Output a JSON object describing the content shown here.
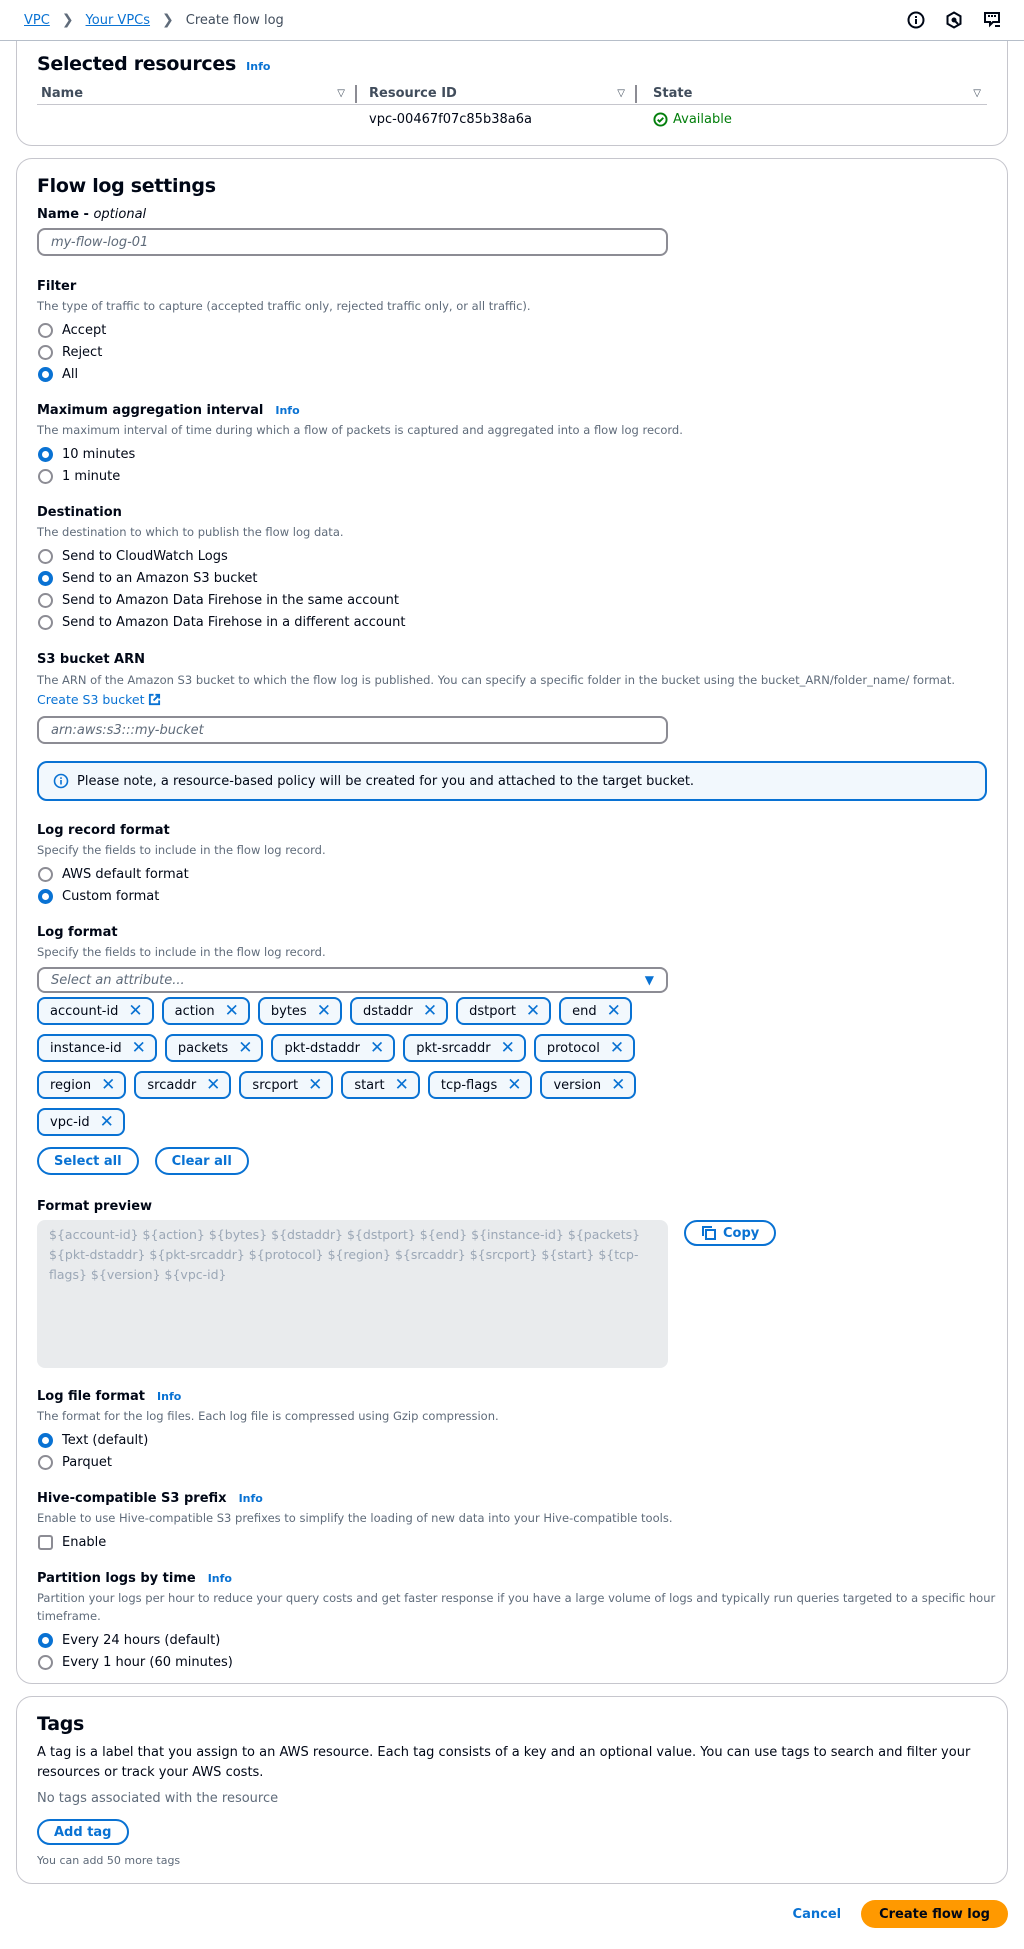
{
  "breadcrumbs": [
    {
      "label": "VPC",
      "link": true
    },
    {
      "label": "Your VPCs",
      "link": true
    },
    {
      "label": "Create flow log",
      "link": false
    }
  ],
  "top_icons": [
    "info-icon",
    "cloudshell-hex-icon",
    "feedback-icon"
  ],
  "selected_resources": {
    "title": "Selected resources",
    "info": "Info",
    "columns": [
      "Name",
      "Resource ID",
      "State"
    ],
    "rows": [
      {
        "name": "",
        "resource_id": "vpc-00467f07c85b38a6a",
        "state": "Available"
      }
    ]
  },
  "flow_log_settings": {
    "title": "Flow log settings",
    "name_label": "Name - ",
    "name_optional": "optional",
    "name_placeholder": "my-flow-log-01",
    "filter": {
      "label": "Filter",
      "description": "The type of traffic to capture (accepted traffic only, rejected traffic only, or all traffic).",
      "options": [
        "Accept",
        "Reject",
        "All"
      ],
      "selected": "All"
    },
    "aggregation": {
      "label": "Maximum aggregation interval",
      "info": "Info",
      "description": "The maximum interval of time during which a flow of packets is captured and aggregated into a flow log record.",
      "options": [
        "10 minutes",
        "1 minute"
      ],
      "selected": "10 minutes"
    },
    "destination": {
      "label": "Destination",
      "description": "The destination to which to publish the flow log data.",
      "options": [
        "Send to CloudWatch Logs",
        "Send to an Amazon S3 bucket",
        "Send to Amazon Data Firehose in the same account",
        "Send to Amazon Data Firehose in a different account"
      ],
      "selected": "Send to an Amazon S3 bucket"
    },
    "s3_arn": {
      "label": "S3 bucket ARN",
      "description": "The ARN of the Amazon S3 bucket to which the flow log is published. You can specify a specific folder in the bucket using the bucket_ARN/folder_name/ format.",
      "create_link": "Create S3 bucket",
      "placeholder": "arn:aws:s3:::my-bucket"
    },
    "alert": "Please note, a resource-based policy will be created for you and attached to the target bucket.",
    "log_record_format": {
      "label": "Log record format",
      "description": "Specify the fields to include in the flow log record.",
      "options": [
        "AWS default format",
        "Custom format"
      ],
      "selected": "Custom format"
    },
    "log_format": {
      "label": "Log format",
      "description": "Specify the fields to include in the flow log record.",
      "placeholder": "Select an attribute...",
      "tokens": [
        "account-id",
        "action",
        "bytes",
        "dstaddr",
        "dstport",
        "end",
        "instance-id",
        "packets",
        "pkt-dstaddr",
        "pkt-srcaddr",
        "protocol",
        "region",
        "srcaddr",
        "srcport",
        "start",
        "tcp-flags",
        "version",
        "vpc-id"
      ],
      "select_all": "Select all",
      "clear_all": "Clear all"
    },
    "format_preview": {
      "label": "Format preview",
      "value": "${account-id} ${action} ${bytes} ${dstaddr} ${dstport} ${end} ${instance-id} ${packets} ${pkt-dstaddr} ${pkt-srcaddr} ${protocol} ${region} ${srcaddr} ${srcport} ${start} ${tcp-flags} ${version} ${vpc-id}",
      "copy": "Copy"
    },
    "log_file_format": {
      "label": "Log file format",
      "info": "Info",
      "description": "The format for the log files. Each log file is compressed using Gzip compression.",
      "options": [
        "Text (default)",
        "Parquet"
      ],
      "selected": "Text (default)"
    },
    "hive_prefix": {
      "label": "Hive-compatible S3 prefix",
      "info": "Info",
      "description": "Enable to use Hive-compatible S3 prefixes to simplify the loading of new data into your Hive-compatible tools.",
      "checkbox_label": "Enable",
      "checked": false
    },
    "partition": {
      "label": "Partition logs by time",
      "info": "Info",
      "description": "Partition your logs per hour to reduce your query costs and get faster response if you have a large volume of logs and typically run queries targeted to a specific hour timeframe.",
      "options": [
        "Every 24 hours (default)",
        "Every 1 hour (60 minutes)"
      ],
      "selected": "Every 24 hours (default)"
    }
  },
  "tags": {
    "title": "Tags",
    "description": "A tag is a label that you assign to an AWS resource. Each tag consists of a key and an optional value. You can use tags to search and filter your resources or track your AWS costs.",
    "empty": "No tags associated with the resource",
    "add_button": "Add tag",
    "remaining": "You can add 50 more tags"
  },
  "footer": {
    "cancel": "Cancel",
    "submit": "Create flow log"
  },
  "colors": {
    "accent": "#0972d3",
    "success": "#037f0c",
    "primary_button": "#ff9900"
  }
}
